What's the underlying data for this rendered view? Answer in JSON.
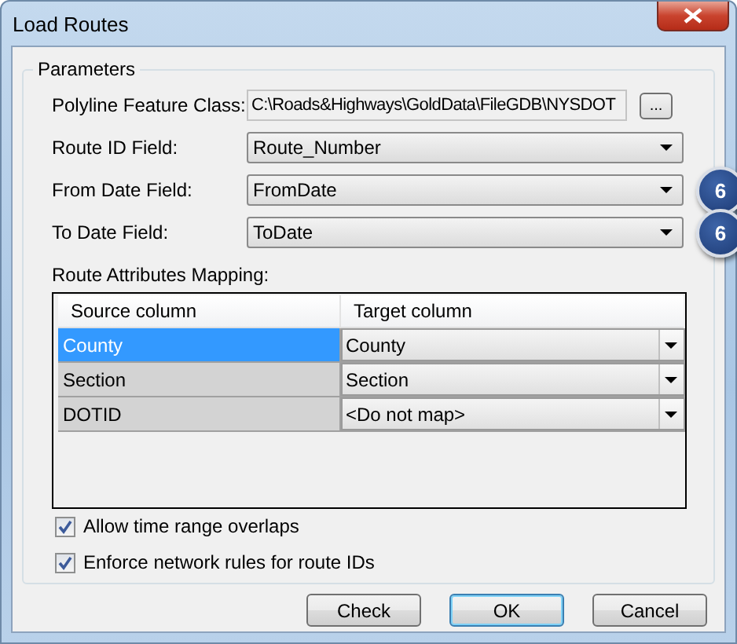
{
  "window": {
    "title": "Load Routes"
  },
  "group": {
    "title": "Parameters"
  },
  "fields": [
    {
      "label": "Polyline Feature Class:",
      "kind": "text",
      "value": "C:\\Roads&Highways\\GoldData\\FileGDB\\NYSDOT",
      "browse": "..."
    },
    {
      "label": "Route ID Field:",
      "kind": "dropdown",
      "value": "Route_Number"
    },
    {
      "label": "From Date Field:",
      "kind": "dropdown",
      "value": "FromDate",
      "badge": "6"
    },
    {
      "label": "To Date Field:",
      "kind": "dropdown",
      "value": "ToDate",
      "badge": "6"
    }
  ],
  "mapping": {
    "label": "Route Attributes Mapping:",
    "columns": [
      "Source column",
      "Target column"
    ],
    "rows": [
      {
        "source": "County",
        "target": "County",
        "selected": true
      },
      {
        "source": "Section",
        "target": "Section",
        "selected": false
      },
      {
        "source": "DOTID",
        "target": "<Do not map>",
        "selected": false
      }
    ]
  },
  "options": [
    {
      "label": "Allow time range overlaps",
      "checked": true
    },
    {
      "label": "Enforce network rules for route IDs",
      "checked": true
    }
  ],
  "buttons": [
    {
      "label": "Check",
      "default": false
    },
    {
      "label": "OK",
      "default": true
    },
    {
      "label": "Cancel",
      "default": false
    }
  ]
}
